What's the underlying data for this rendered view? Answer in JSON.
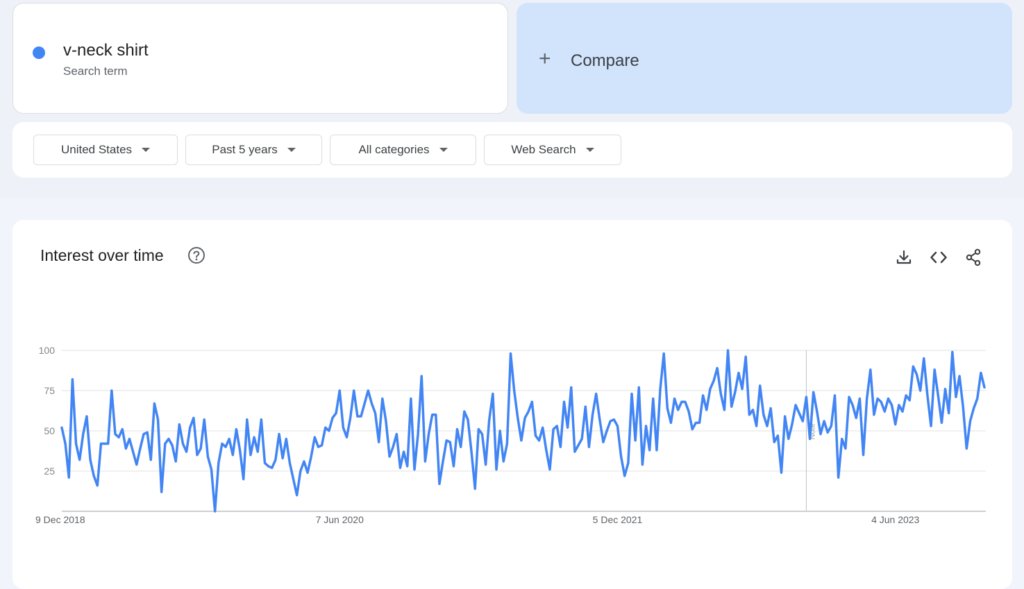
{
  "search_term": {
    "label": "v-neck shirt",
    "sublabel": "Search term",
    "color": "#4285f4"
  },
  "compare": {
    "plus": "+",
    "label": "Compare"
  },
  "filters": [
    {
      "label": "United States"
    },
    {
      "label": "Past 5 years"
    },
    {
      "label": "All categories"
    },
    {
      "label": "Web Search"
    }
  ],
  "panel": {
    "title": "Interest over time",
    "icons": [
      "help-icon",
      "download-icon",
      "embed-icon",
      "share-icon"
    ]
  },
  "chart_data": {
    "type": "line",
    "title": "Interest over time",
    "x_tick_labels": [
      "9 Dec 2018",
      "7 Jun 2020",
      "5 Dec 2021",
      "4 Jun 2023"
    ],
    "y_tick_labels": [
      "25",
      "50",
      "75",
      "100"
    ],
    "ylim": [
      0,
      100
    ],
    "grid": true,
    "note_marker": {
      "label": "Note",
      "at_week": 209
    },
    "series": [
      {
        "color": "#4285f4",
        "x_start": "9 Dec 2018",
        "x_interval": "week",
        "values": [
          52,
          42,
          21,
          82,
          42,
          32,
          48,
          59,
          32,
          22,
          16,
          42,
          42,
          42,
          75,
          48,
          46,
          51,
          39,
          45,
          37,
          29,
          39,
          48,
          49,
          32,
          67,
          57,
          12,
          42,
          45,
          41,
          31,
          54,
          42,
          37,
          52,
          58,
          35,
          39,
          57,
          34,
          26,
          0,
          30,
          42,
          40,
          45,
          35,
          51,
          38,
          20,
          57,
          35,
          46,
          37,
          57,
          30,
          28,
          27,
          32,
          48,
          33,
          45,
          30,
          20,
          10,
          25,
          31,
          24,
          34,
          46,
          40,
          41,
          52,
          50,
          58,
          61,
          75,
          52,
          46,
          58,
          75,
          59,
          59,
          67,
          75,
          67,
          61,
          43,
          70,
          56,
          34,
          40,
          48,
          27,
          37,
          28,
          70,
          26,
          48,
          84,
          31,
          48,
          60,
          60,
          17,
          31,
          44,
          43,
          28,
          51,
          40,
          62,
          57,
          37,
          14,
          51,
          48,
          29,
          57,
          73,
          26,
          50,
          31,
          42,
          98,
          75,
          58,
          44,
          58,
          62,
          68,
          47,
          44,
          52,
          38,
          26,
          51,
          53,
          40,
          68,
          52,
          77,
          37,
          41,
          45,
          65,
          40,
          60,
          73,
          57,
          43,
          50,
          56,
          57,
          53,
          34,
          22,
          30,
          73,
          44,
          77,
          29,
          53,
          38,
          70,
          38,
          76,
          98,
          64,
          55,
          70,
          63,
          68,
          68,
          62,
          51,
          55,
          55,
          72,
          63,
          76,
          81,
          89,
          73,
          63,
          100,
          65,
          74,
          86,
          76,
          96,
          60,
          63,
          53,
          78,
          60,
          53,
          64,
          43,
          47,
          24,
          59,
          45,
          54,
          66,
          61,
          56,
          71,
          45,
          74,
          62,
          48,
          56,
          49,
          53,
          72,
          21,
          45,
          39,
          71,
          66,
          58,
          70,
          35,
          70,
          88,
          60,
          70,
          68,
          62,
          70,
          66,
          54,
          66,
          62,
          72,
          69,
          90,
          85,
          75,
          95,
          72,
          53,
          88,
          72,
          55,
          76,
          61,
          99,
          71,
          84,
          65,
          39,
          56,
          64,
          70,
          86,
          77
        ]
      }
    ]
  }
}
